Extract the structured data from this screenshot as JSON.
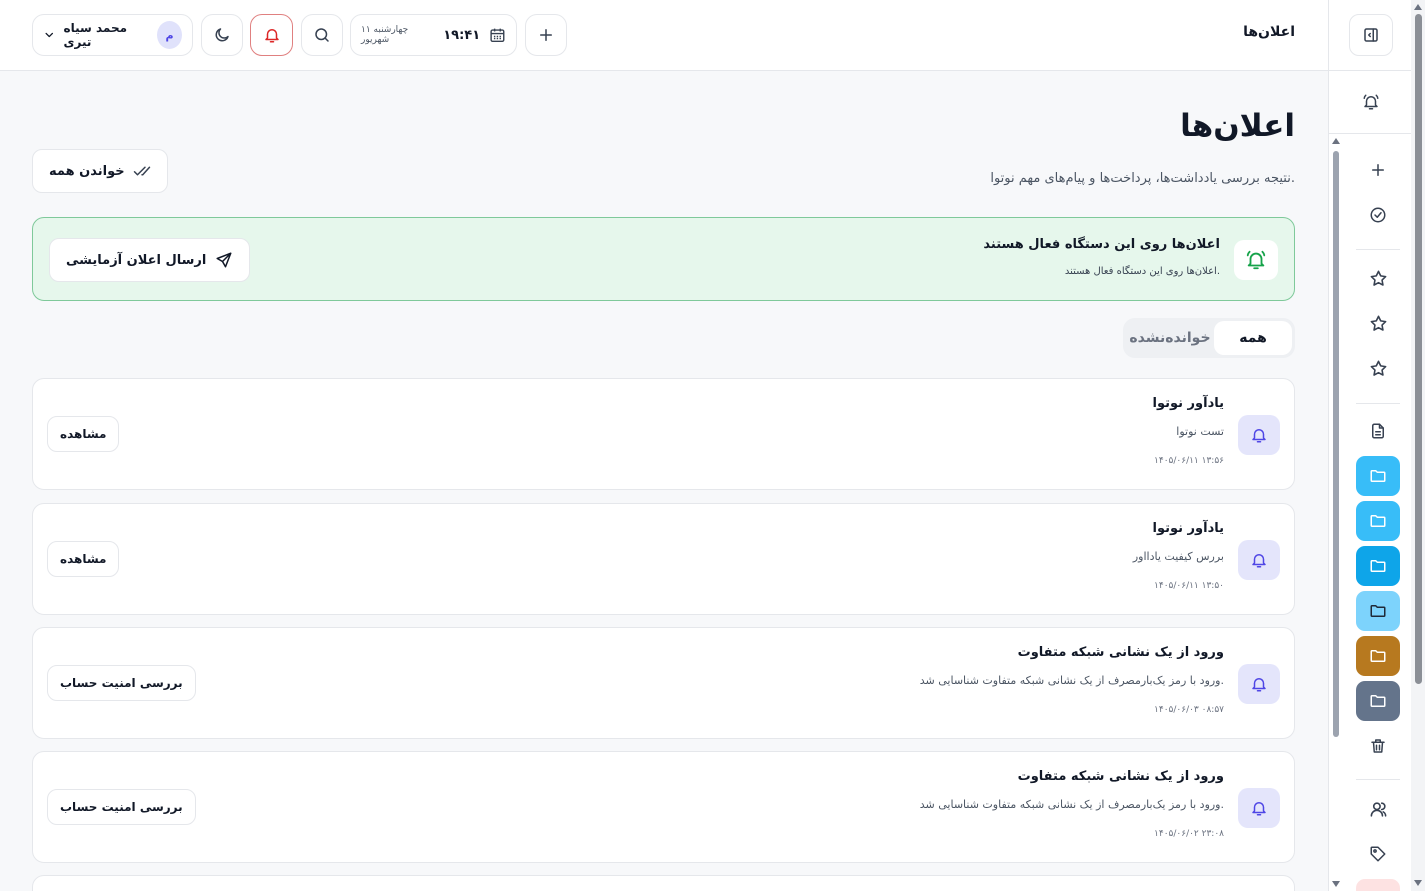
{
  "header": {
    "title": "اعلان‌ها",
    "clock_day": "چهارشنبه ۱۱ شهریور",
    "clock_time": "۱۹:۴۱",
    "user_initial": "م",
    "user_name": "محمد سیاه تیری",
    "icons": [
      "plus-icon",
      "calendar-icon",
      "search-icon",
      "bell-icon",
      "moon-icon",
      "chevron-down-icon"
    ]
  },
  "page": {
    "title": "اعلان‌ها",
    "subtitle": "نتیجه بررسی یادداشت‌ها، پرداخت‌ها و پیام‌های مهم نوتوا.",
    "read_all": "خواندن همه"
  },
  "banner": {
    "title": "اعلان‌ها روی این دستگاه فعال هستند",
    "subtitle": "اعلان‌ها روی این دستگاه فعال هستند.",
    "button": "ارسال اعلان آزمایشی"
  },
  "tabs": [
    {
      "label": "همه",
      "active": true
    },
    {
      "label": "خوانده‌نشده",
      "active": false
    }
  ],
  "notifications": [
    {
      "title": "یادآور نوتوا",
      "body": "تست نوتوا",
      "time": "۱۴۰۵/۰۶/۱۱ ۱۳:۵۶",
      "action": "مشاهده"
    },
    {
      "title": "یادآور نوتوا",
      "body": "بررس کیفیت یادااور",
      "time": "۱۴۰۵/۰۶/۱۱ ۱۳:۵۰",
      "action": "مشاهده"
    },
    {
      "title": "ورود از یک نشانی شبکه متفاوت",
      "body": "ورود با رمز یک‌بارمصرف از یک نشانی شبکه متفاوت شناسایی شد.",
      "time": "۱۴۰۵/۰۶/۰۳ ۰۸:۵۷",
      "action": "بررسی امنیت حساب"
    },
    {
      "title": "ورود از یک نشانی شبکه متفاوت",
      "body": "ورود با رمز یک‌بارمصرف از یک نشانی شبکه متفاوت شناسایی شد.",
      "time": "۱۴۰۵/۰۶/۰۲ ۲۳:۰۸",
      "action": "بررسی امنیت حساب"
    }
  ],
  "sidebar": {
    "items": [
      {
        "icon": "sidebar-toggle-icon"
      },
      {
        "icon": "bell-ring-icon"
      },
      {
        "icon": "plus-icon"
      },
      {
        "icon": "check-circle-icon"
      },
      {
        "icon": "star-icon"
      },
      {
        "icon": "star-icon"
      },
      {
        "icon": "star-icon"
      },
      {
        "icon": "document-icon"
      },
      {
        "icon": "folder-icon",
        "color": "#38bdf8"
      },
      {
        "icon": "folder-icon",
        "color": "#38bdf8"
      },
      {
        "icon": "folder-icon",
        "color": "#0ea5e9"
      },
      {
        "icon": "folder-icon",
        "color": "#7dd3fc"
      },
      {
        "icon": "folder-icon",
        "color": "#b7791f"
      },
      {
        "icon": "folder-icon",
        "color": "#64748b"
      },
      {
        "icon": "trash-icon"
      },
      {
        "icon": "users-icon"
      },
      {
        "icon": "tag-icon"
      }
    ]
  },
  "colors": {
    "accent": "#4f46e5",
    "success_bg": "#e6f7ec",
    "success_border": "#7fc99a",
    "danger": "#dc2626"
  }
}
